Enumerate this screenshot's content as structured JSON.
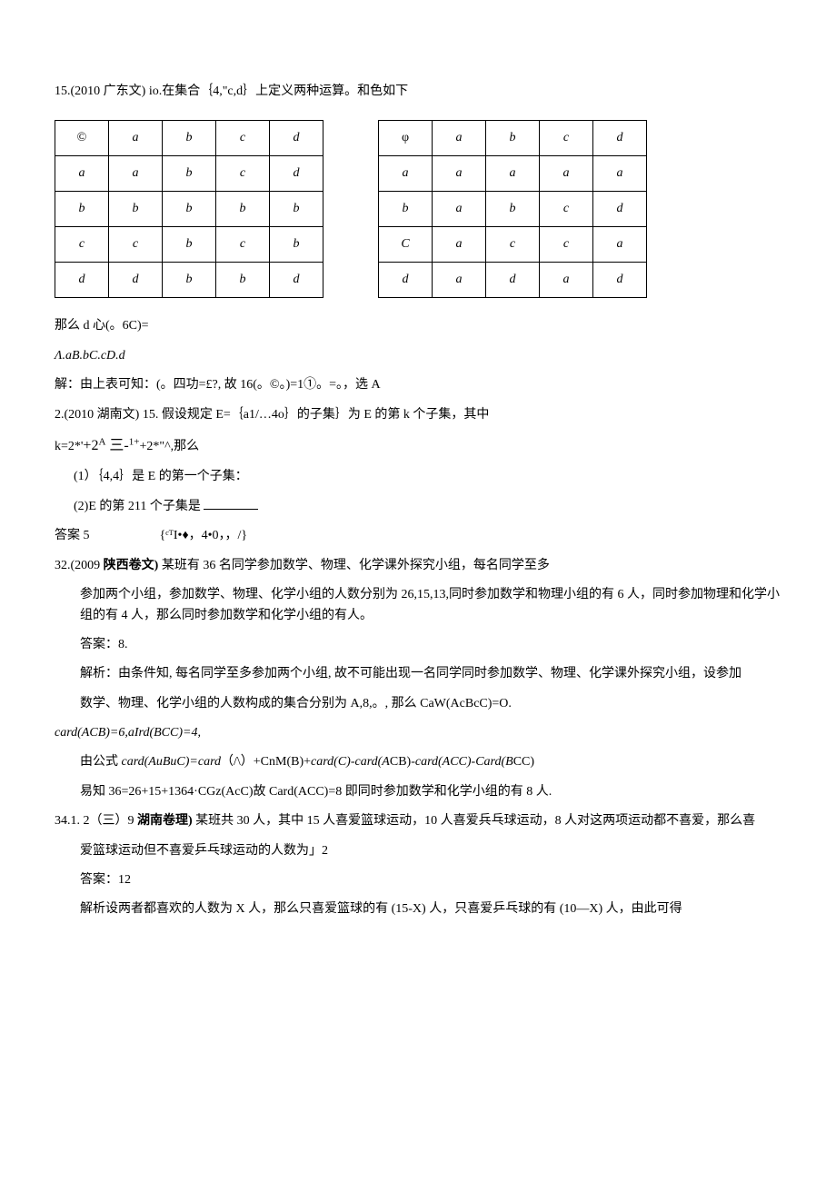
{
  "q15": {
    "title": "15.(2010 广东文) io.在集合｛4,\"c,d｝上定义两种运算。和色如下",
    "table1": [
      [
        "©",
        "a",
        "b",
        "c",
        "d"
      ],
      [
        "a",
        "a",
        "b",
        "c",
        "d"
      ],
      [
        "b",
        "b",
        "b",
        "b",
        "b"
      ],
      [
        "c",
        "c",
        "b",
        "c",
        "b"
      ],
      [
        "d",
        "d",
        "b",
        "b",
        "d"
      ]
    ],
    "table2": [
      [
        "φ",
        "a",
        "b",
        "c",
        "d"
      ],
      [
        "a",
        "a",
        "a",
        "a",
        "a"
      ],
      [
        "b",
        "a",
        "b",
        "c",
        "d"
      ],
      [
        "C",
        "a",
        "c",
        "c",
        "a"
      ],
      [
        "d",
        "a",
        "d",
        "a",
        "d"
      ]
    ],
    "line2": "那么 d 心(。6C)=",
    "line3": "Λ.aB.bC.cD.d",
    "line4": "解：由上表可知：(。四功=£?, 故 16(。©。)=1①。=。，选 A"
  },
  "q2": {
    "title": "2.(2010 湖南文) 15. 假设规定 E=｛a1/…4o｝的子集｝为 E 的第 k 个子集，其中",
    "line2_a": "k=2*'",
    "line2_b": "+2",
    "line2_c": "A",
    "line2_d": " 三-",
    "line2_e": "1+",
    "line2_f": "+2*\"^,那么",
    "sub1": "(1）｛4,4｝是 E 的第一个子集：",
    "sub2_a": "(2)E 的第 211 个子集是 ",
    "ans_a": "答案 5",
    "ans_b": "{ᶜᵀI•♦，4•0，，/}"
  },
  "q32": {
    "title_a": "32.(2009 ",
    "title_b": "陕西卷文) ",
    "title_c": "某班有 36 名同学参加数学、物理、化学课外探究小组，每名同学至多",
    "p1": "参加两个小组，参加数学、物理、化学小组的人数分别为 26,15,13,同时参加数学和物理小组的有 6 人，同时参加物理和化学小组的有 4 人，那么同时参加数学和化学小组的有人。",
    "p2": "答案：8.",
    "p3": "解析：由条件知, 每名同学至多参加两个小组, 故不可能出现一名同学同时参加数学、物理、化学课外探究小组，设参加",
    "p4": "数学、物理、化学小组的人数构成的集合分别为 A,8,。, 那么 CaW(AcBcC)=O.",
    "p5": "card(ACB)=6,aIrd(BCC)=4,",
    "p6_a": "由公式 ",
    "p6_b": "card(AuBuC)=card",
    "p6_c": "（/\\）+CnM(B)+",
    "p6_d": "card(C)-card(A",
    "p6_e": "CB)-",
    "p6_f": "card(ACC)-Card(B",
    "p6_g": "CC)",
    "p7": "易知 36=26+15+1364·CGz(AcC)故 Card(ACC)=8 即同时参加数学和化学小组的有 8 人."
  },
  "q34": {
    "title_a": "34.1.  2（三）9 ",
    "title_b": "湖南卷理) ",
    "title_c": "某班共 30 人，其中 15 人喜爱篮球运动，10 人喜爱兵乓球运动，8 人对这两项运动都不喜爱，那么喜",
    "p1": "爱篮球运动但不喜爱乒乓球运动的人数为」2",
    "p2": "答案：12",
    "p3": "解析设两者都喜欢的人数为 X 人，那么只喜爱篮球的有 (15-X) 人，只喜爱乒乓球的有 (10—X) 人，由此可得"
  }
}
